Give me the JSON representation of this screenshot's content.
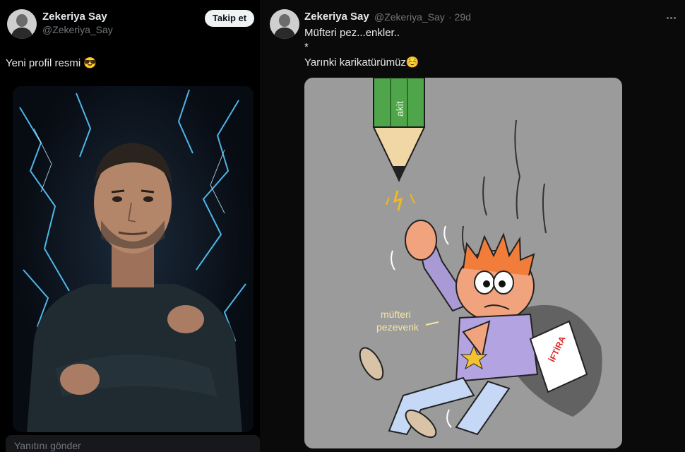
{
  "left_tweet": {
    "author_name": "Zekeriya Say",
    "author_handle": "@Zekeriya_Say",
    "follow_label": "Takip et",
    "text": "Yeni profil resmi 😎",
    "reply_placeholder": "Yanıtını gönder"
  },
  "right_tweet": {
    "author_name": "Zekeriya Say",
    "author_handle": "@Zekeriya_Say",
    "time": "· 29d",
    "line1": "Müfteri pez...enkler..",
    "line2": "*",
    "line3": "Yarınki karikatürümüz☺️",
    "cartoon_pencil_label": "akit",
    "cartoon_caption_line1": "müfteri",
    "cartoon_caption_line2": "pezevenk",
    "cartoon_paper_label": "İFTİRA"
  }
}
